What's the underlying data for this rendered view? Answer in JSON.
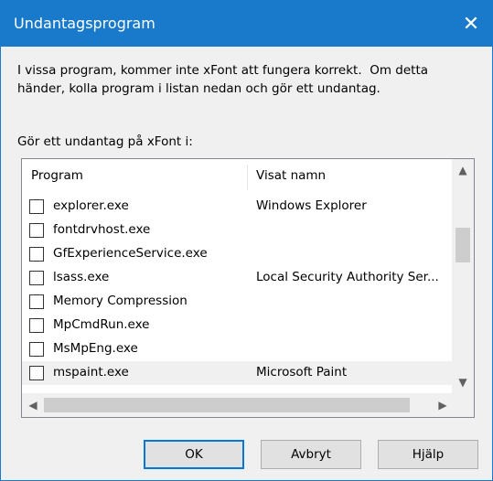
{
  "window": {
    "title": "Undantagsprogram",
    "close_glyph": "✕"
  },
  "message": "I vissa program, kommer inte xFont att fungera korrekt.  Om detta händer, kolla program i listan nedan och gör ett undantag.",
  "exception_label": "Gör ett undantag på xFont i:",
  "list": {
    "columns": [
      "Program",
      "Visat namn"
    ],
    "rows": [
      {
        "program": "explorer.exe",
        "display_name": "Windows Explorer",
        "checked": false
      },
      {
        "program": "fontdrvhost.exe",
        "display_name": "",
        "checked": false
      },
      {
        "program": "GfExperienceService.exe",
        "display_name": "",
        "checked": false
      },
      {
        "program": "lsass.exe",
        "display_name": "Local Security Authority Ser...",
        "checked": false
      },
      {
        "program": "Memory Compression",
        "display_name": "",
        "checked": false
      },
      {
        "program": "MpCmdRun.exe",
        "display_name": "",
        "checked": false
      },
      {
        "program": "MsMpEng.exe",
        "display_name": "",
        "checked": false
      },
      {
        "program": "mspaint.exe",
        "display_name": "Microsoft Paint",
        "checked": false
      }
    ],
    "scroll_up": "▲",
    "scroll_down": "▼",
    "scroll_left": "◀",
    "scroll_right": "▶"
  },
  "buttons": {
    "ok": "OK",
    "cancel": "Avbryt",
    "help": "Hjälp"
  }
}
